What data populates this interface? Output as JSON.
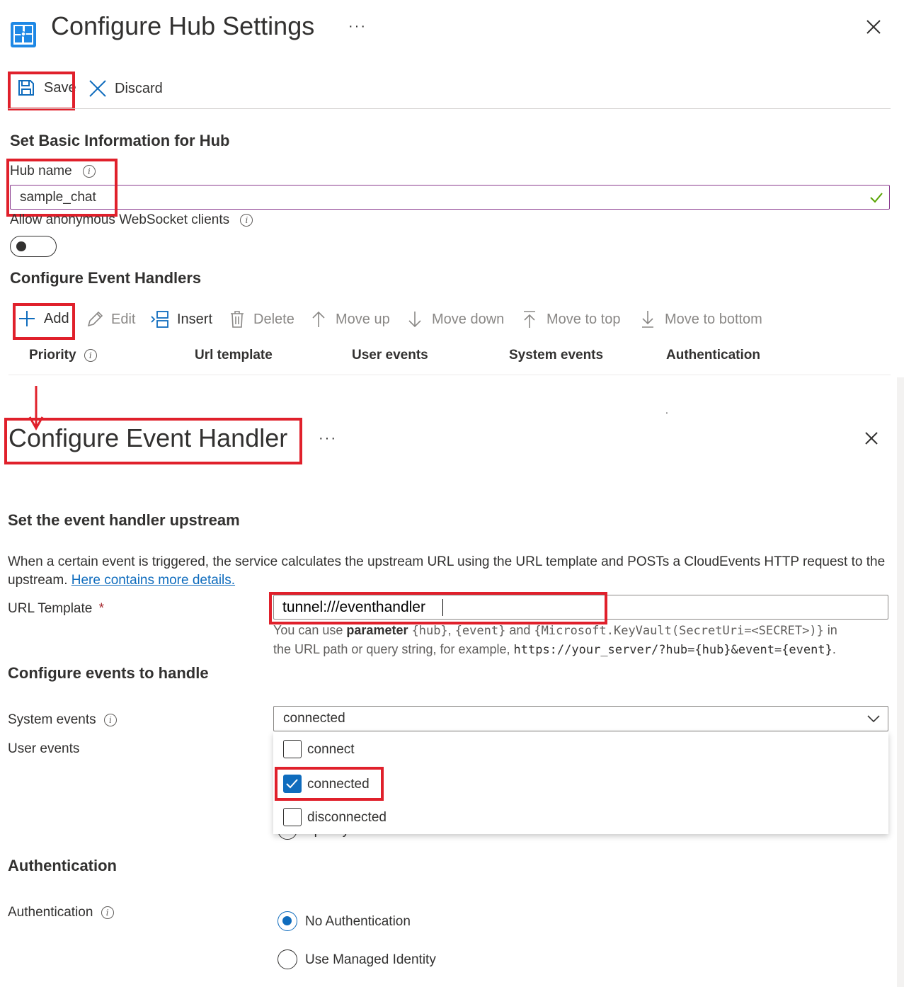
{
  "hub": {
    "title": "Configure Hub Settings",
    "more": "···",
    "toolbar": {
      "save": "Save",
      "discard": "Discard"
    },
    "basic_section": "Set Basic Information for Hub",
    "hub_name_label": "Hub name",
    "hub_name_value": "sample_chat",
    "anonymous_label": "Allow anonymous WebSocket clients",
    "handlers_section": "Configure Event Handlers",
    "handler_toolbar": {
      "add": "Add",
      "edit": "Edit",
      "insert": "Insert",
      "delete": "Delete",
      "move_up": "Move up",
      "move_down": "Move down",
      "move_top": "Move to top",
      "move_bottom": "Move to bottom"
    },
    "columns": [
      "Priority",
      "Url template",
      "User events",
      "System events",
      "Authentication"
    ],
    "stray_dot": "."
  },
  "handler": {
    "title": "Configure Event Handler",
    "more": "···",
    "upstream_section": "Set the event handler upstream",
    "desc_text": "When a certain event is triggered, the service calculates the upstream URL using the URL template and POSTs a CloudEvents HTTP request to the upstream.",
    "desc_link": "Here contains more details.",
    "url_label": "URL Template",
    "required_mark": "*",
    "url_value": "tunnel:///eventhandler",
    "hint": {
      "p1": "You can use ",
      "p2": "parameter",
      "c1": "{hub}",
      "s1": ", ",
      "c2": "{event}",
      "s2": " and ",
      "c3": "{Microsoft.KeyVault(SecretUri=<SECRET>)}",
      "s3": " in",
      "p4": "the URL path or query string, for example, ",
      "c4": "https://your_server/?hub={hub}&event={event}",
      "s4": "."
    },
    "events_section": "Configure events to handle",
    "system_events_label": "System events",
    "system_events_value": "connected",
    "user_events_label": "User events",
    "options": [
      {
        "label": "connect",
        "checked": false
      },
      {
        "label": "connected",
        "checked": true
      },
      {
        "label": "disconnected",
        "checked": false
      }
    ],
    "hidden_radio_label": "Specify",
    "auth_section": "Authentication",
    "auth_label": "Authentication",
    "auth_options": [
      {
        "label": "No Authentication",
        "selected": true
      },
      {
        "label": "Use Managed Identity",
        "selected": false
      }
    ]
  },
  "colors": {
    "highlight": "#e0202b",
    "accent": "#0f6cbd",
    "link": "#0f6cbd",
    "valid_check": "#57a300"
  }
}
